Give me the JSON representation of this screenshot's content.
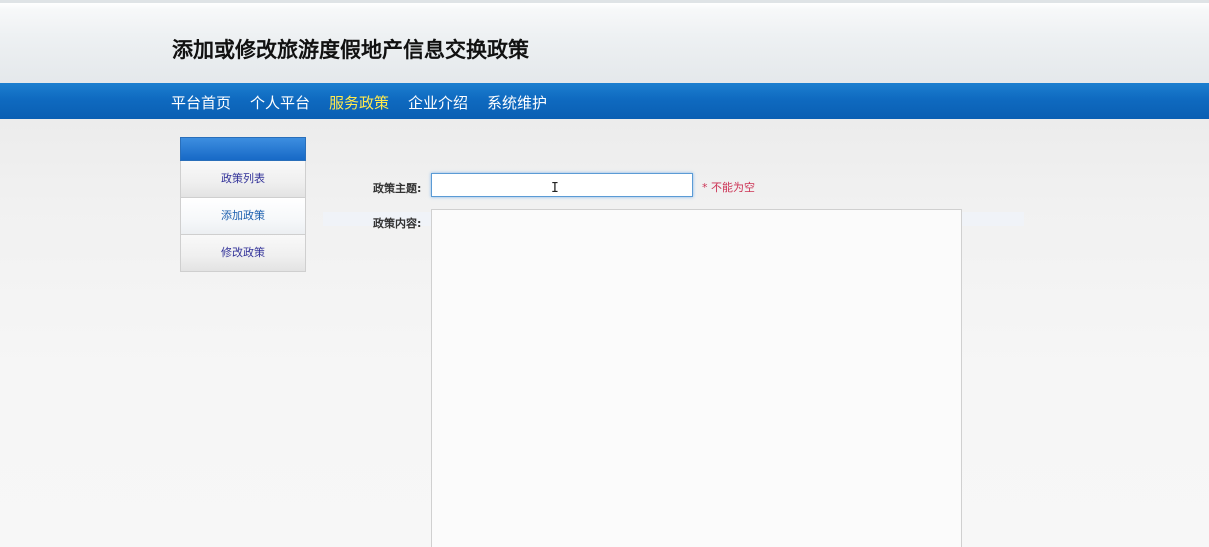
{
  "header": {
    "title": "添加或修改旅游度假地产信息交换政策"
  },
  "nav": {
    "items": [
      {
        "label": "平台首页",
        "active": false
      },
      {
        "label": "个人平台",
        "active": false
      },
      {
        "label": "服务政策",
        "active": true
      },
      {
        "label": "企业介绍",
        "active": false
      },
      {
        "label": "系统维护",
        "active": false
      }
    ]
  },
  "sidemenu": {
    "items": [
      {
        "label": "政策列表",
        "active": false
      },
      {
        "label": "添加政策",
        "active": true
      },
      {
        "label": "修改政策",
        "active": false
      }
    ]
  },
  "form": {
    "subject_label": "政策主题:",
    "subject_value": "",
    "required_note": "* 不能为空",
    "content_label": "政策内容:"
  },
  "colors": {
    "nav_bg": "#0f6ac0",
    "nav_active": "#ffe94d",
    "required": "#cc3355",
    "input_focus_border": "#5b9bd5"
  }
}
